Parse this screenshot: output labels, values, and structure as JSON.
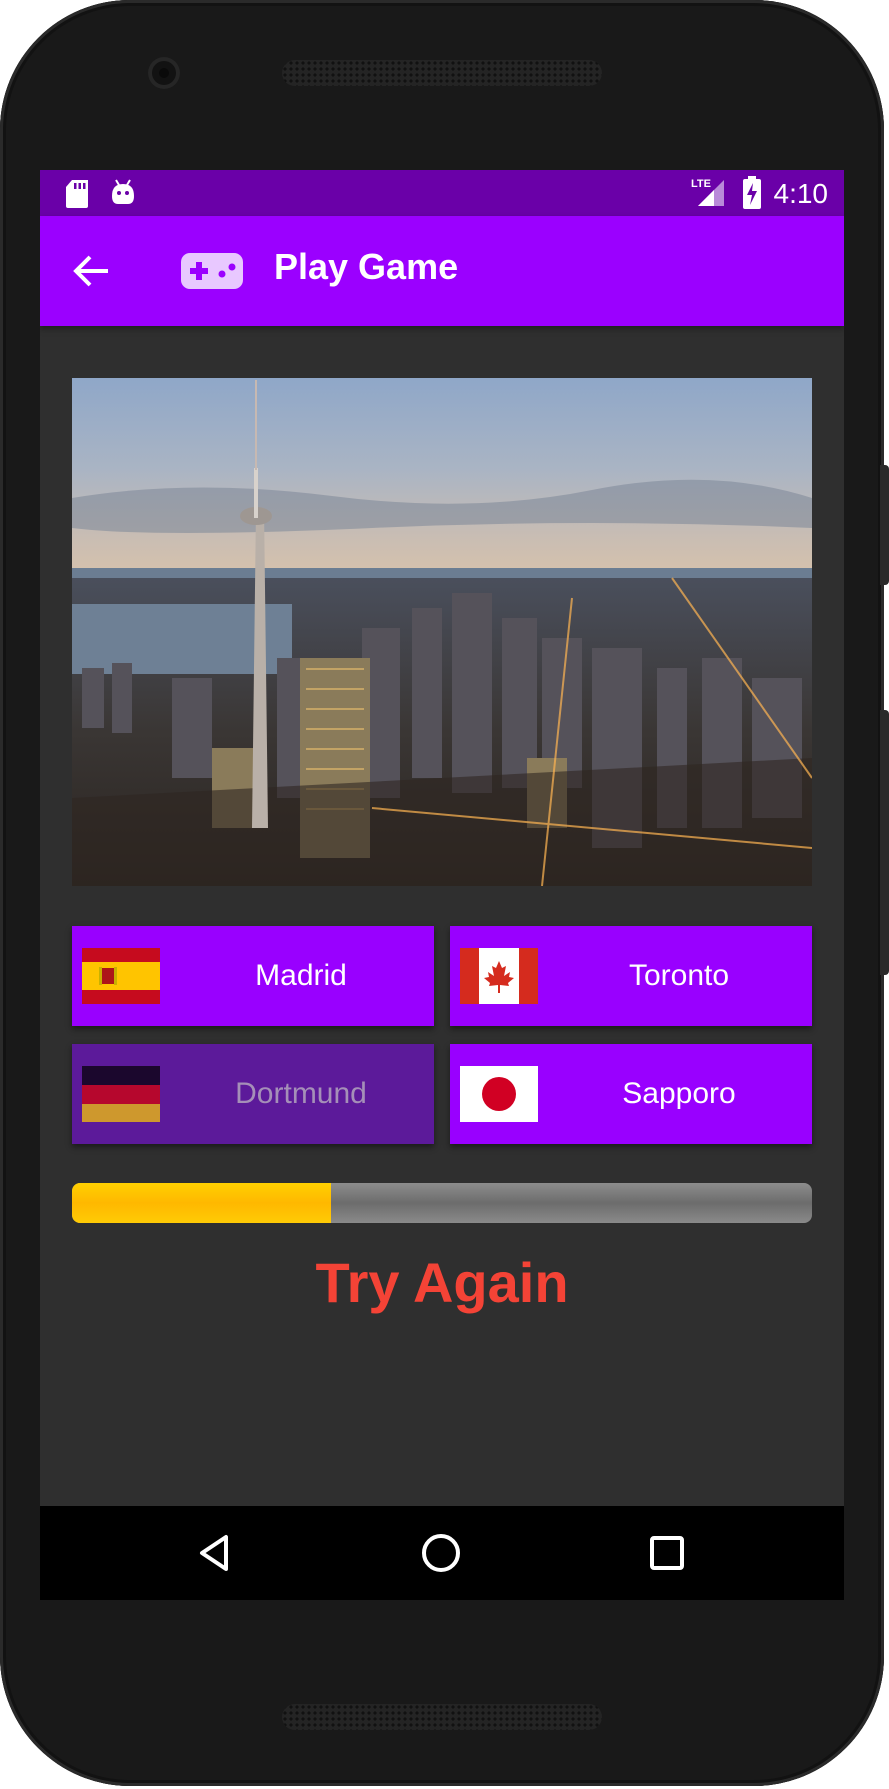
{
  "status_bar": {
    "time": "4:10",
    "network": "LTE",
    "icons": [
      "sd-card-icon",
      "android-icon",
      "lte-signal-icon",
      "battery-charging-icon"
    ]
  },
  "app_bar": {
    "title": "Play Game",
    "back_icon": "arrow-back-icon",
    "title_icon": "gamepad-icon",
    "color": "#9b00ff"
  },
  "answers": [
    {
      "label": "Madrid",
      "flag": "spain-flag-icon",
      "enabled": true
    },
    {
      "label": "Toronto",
      "flag": "canada-flag-icon",
      "enabled": true
    },
    {
      "label": "Dortmund",
      "flag": "germany-flag-icon",
      "enabled": false
    },
    {
      "label": "Sapporo",
      "flag": "japan-flag-icon",
      "enabled": true
    }
  ],
  "progress": {
    "value": 0.35,
    "color": "#ffbf00"
  },
  "result_text": "Try Again",
  "result_color": "#f44336",
  "nav_bar": {
    "icons": [
      "back-triangle-icon",
      "home-circle-icon",
      "recents-square-icon"
    ]
  }
}
